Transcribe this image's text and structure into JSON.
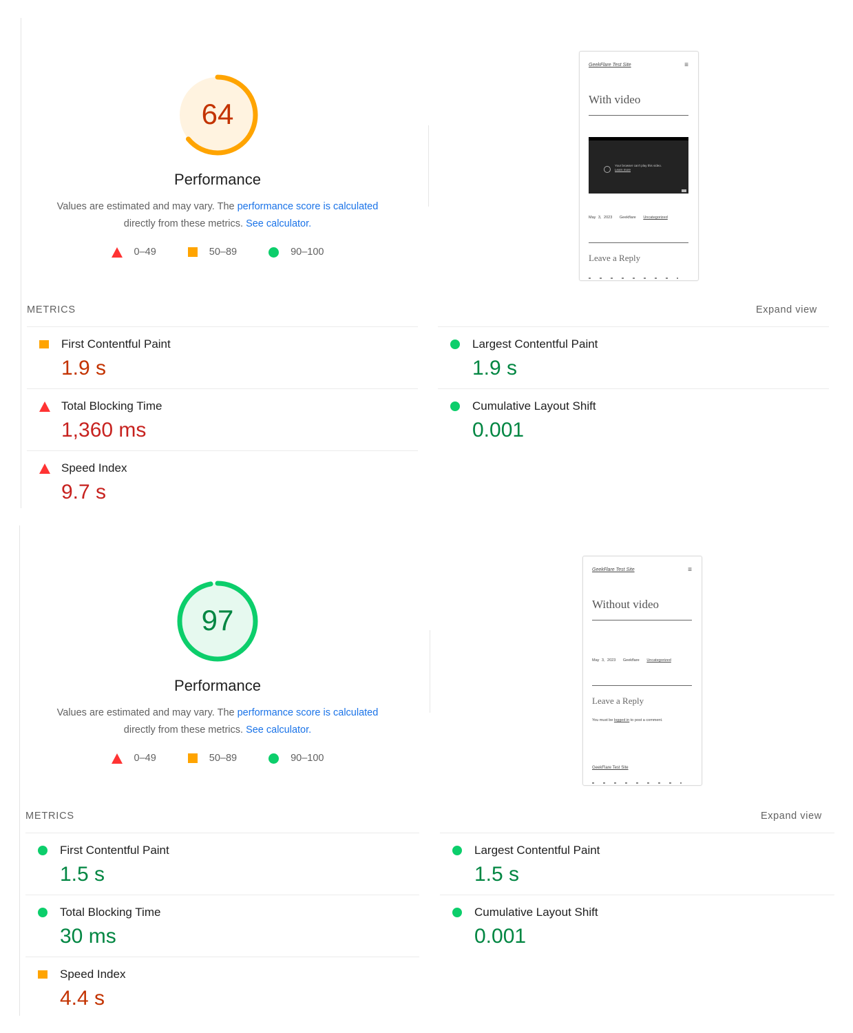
{
  "colors": {
    "fail": "#ff3333",
    "average": "#ffa400",
    "pass": "#0cce6b",
    "fail_text": "#c7221f",
    "average_text": "#c33300",
    "pass_text": "#018642",
    "link": "#1a73e8"
  },
  "reports": [
    {
      "score": "64",
      "score_fraction": 0.64,
      "rating": "average",
      "category_title": "Performance",
      "description": {
        "text_before": "Values are estimated and may vary. The ",
        "link1": "performance score is calculated",
        "text_middle": " directly from these metrics. ",
        "link2": "See calculator",
        "text_after": "."
      },
      "legend": [
        {
          "icon": "triangle-icon",
          "range": "0–49"
        },
        {
          "icon": "square-icon",
          "range": "50–89"
        },
        {
          "icon": "circle-icon",
          "range": "90–100"
        }
      ],
      "screenshot": {
        "site_name": "GeekFlare Test Site",
        "menu_icon": "hamburger-icon",
        "post_title": "With video",
        "video_message": "Your browser can't play this video.",
        "video_link": "Learn more",
        "meta_date": "May 3, 2023",
        "meta_author": "Geekflare",
        "meta_category": "Uncategorized",
        "reply_heading": "Leave a Reply"
      },
      "metrics_label": "METRICS",
      "expand_label": "Expand view",
      "metrics_left": [
        {
          "title": "First Contentful Paint",
          "value": "1.9 s",
          "rating": "average"
        },
        {
          "title": "Total Blocking Time",
          "value": "1,360 ms",
          "rating": "fail"
        },
        {
          "title": "Speed Index",
          "value": "9.7 s",
          "rating": "fail"
        }
      ],
      "metrics_right": [
        {
          "title": "Largest Contentful Paint",
          "value": "1.9 s",
          "rating": "pass"
        },
        {
          "title": "Cumulative Layout Shift",
          "value": "0.001",
          "rating": "pass"
        }
      ]
    },
    {
      "score": "97",
      "score_fraction": 0.97,
      "rating": "pass",
      "category_title": "Performance",
      "description": {
        "text_before": "Values are estimated and may vary. The ",
        "link1": "performance score is calculated",
        "text_middle": " directly from these metrics. ",
        "link2": "See calculator",
        "text_after": "."
      },
      "legend": [
        {
          "icon": "triangle-icon",
          "range": "0–49"
        },
        {
          "icon": "square-icon",
          "range": "50–89"
        },
        {
          "icon": "circle-icon",
          "range": "90–100"
        }
      ],
      "screenshot": {
        "site_name": "GeekFlare Test Site",
        "menu_icon": "hamburger-icon",
        "post_title": "Without video",
        "meta_date": "May 3, 2023",
        "meta_author": "Geekflare",
        "meta_category": "Uncategorized",
        "reply_heading": "Leave a Reply",
        "reply_text_before": "You must be ",
        "reply_link": "logged in",
        "reply_text_after": " to post a comment.",
        "footer_site": "GeekFlare Test Site"
      },
      "metrics_label": "METRICS",
      "expand_label": "Expand view",
      "metrics_left": [
        {
          "title": "First Contentful Paint",
          "value": "1.5 s",
          "rating": "pass"
        },
        {
          "title": "Total Blocking Time",
          "value": "30 ms",
          "rating": "pass"
        },
        {
          "title": "Speed Index",
          "value": "4.4 s",
          "rating": "average"
        }
      ],
      "metrics_right": [
        {
          "title": "Largest Contentful Paint",
          "value": "1.5 s",
          "rating": "pass"
        },
        {
          "title": "Cumulative Layout Shift",
          "value": "0.001",
          "rating": "pass"
        }
      ]
    }
  ]
}
